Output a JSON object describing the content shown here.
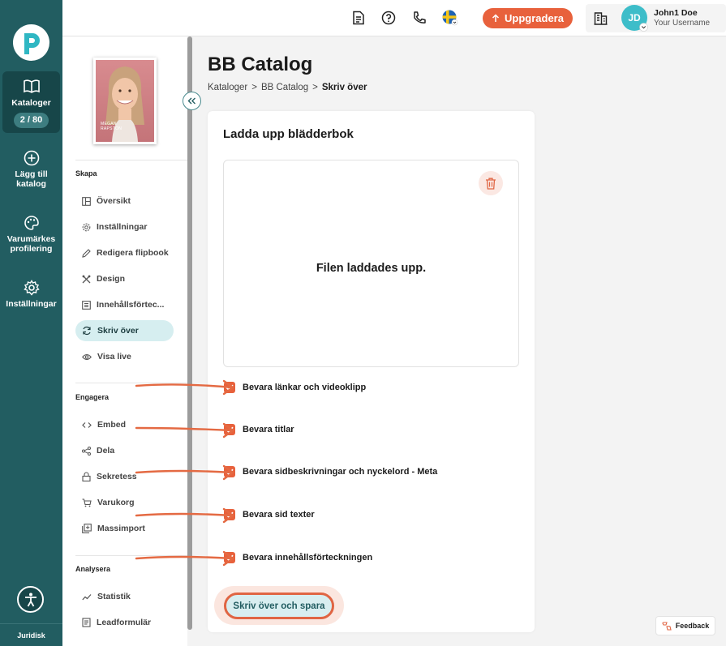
{
  "rail": {
    "items": [
      {
        "label": "Kataloger",
        "badge": "2 / 80"
      },
      {
        "label": "Lägg till katalog"
      },
      {
        "label": "Varumärkes profilering"
      },
      {
        "label": "Inställningar"
      }
    ],
    "bottom_link": "Juridisk"
  },
  "topbar": {
    "upgrade_label": "Uppgradera",
    "user": {
      "initials": "JD",
      "name": "John1 Doe",
      "username": "Your Username"
    }
  },
  "sidebar": {
    "cover_lines": [
      "MEGAN",
      "RAPSTON"
    ],
    "sections": [
      {
        "title": "Skapa",
        "items": [
          "Översikt",
          "Inställningar",
          "Redigera flipbook",
          "Design",
          "Innehållsförtec...",
          "Skriv över",
          "Visa live"
        ]
      },
      {
        "title": "Engagera",
        "items": [
          "Embed",
          "Dela",
          "Sekretess",
          "Varukorg",
          "Massimport"
        ]
      },
      {
        "title": "Analysera",
        "items": [
          "Statistik",
          "Leadformulär"
        ]
      }
    ]
  },
  "main": {
    "title": "BB Catalog",
    "breadcrumb": [
      "Kataloger",
      "BB Catalog",
      "Skriv över"
    ],
    "card": {
      "title": "Ladda upp blädderbok",
      "upload_message": "Filen laddades upp.",
      "options": [
        "Bevara länkar och videoklipp",
        "Bevara titlar",
        "Bevara sidbeskrivningar och nyckelord - Meta",
        "Bevara sid texter",
        "Bevara innehållsförteckningen"
      ],
      "save_label": "Skriv över och spara"
    }
  },
  "feedback_label": "Feedback",
  "colors": {
    "rail": "#225d61",
    "accent": "#e8613c",
    "active_nav": "#d6eef0"
  }
}
